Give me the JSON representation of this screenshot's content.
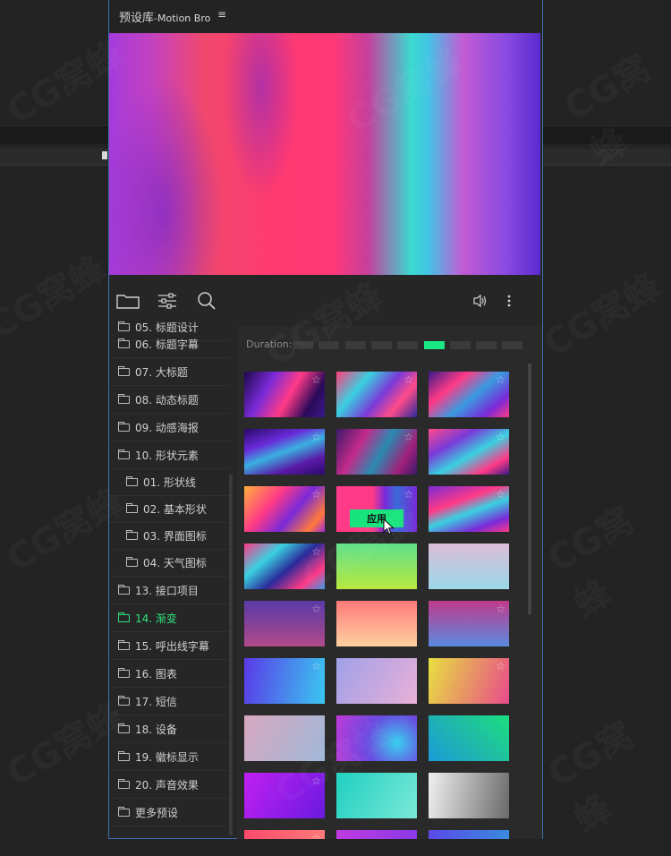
{
  "panel": {
    "title": "预设库",
    "title_sub": "-Motion Bro",
    "menu_glyph": "≡"
  },
  "toolbar": {
    "left_icons": [
      "folder-icon",
      "sliders-icon",
      "search-icon"
    ],
    "right_icons": [
      "speaker-icon",
      "more-vertical-icon"
    ]
  },
  "sidebar": {
    "items": [
      {
        "label": "05. 标题设计",
        "indent": false,
        "active": false
      },
      {
        "label": "06. 标题字幕",
        "indent": false,
        "active": false
      },
      {
        "label": "07. 大标题",
        "indent": false,
        "active": false
      },
      {
        "label": "08. 动态标题",
        "indent": false,
        "active": false
      },
      {
        "label": "09. 动感海报",
        "indent": false,
        "active": false
      },
      {
        "label": "10. 形状元素",
        "indent": false,
        "active": false,
        "open": true
      },
      {
        "label": "01. 形状线",
        "indent": true,
        "active": false
      },
      {
        "label": "02. 基本形状",
        "indent": true,
        "active": false
      },
      {
        "label": "03. 界面图标",
        "indent": true,
        "active": false
      },
      {
        "label": "04. 天气图标",
        "indent": true,
        "active": false
      },
      {
        "label": "13. 接口项目",
        "indent": false,
        "active": false
      },
      {
        "label": "14. 渐变",
        "indent": false,
        "active": true
      },
      {
        "label": "15. 呼出线字幕",
        "indent": false,
        "active": false
      },
      {
        "label": "16. 图表",
        "indent": false,
        "active": false
      },
      {
        "label": "17. 短信",
        "indent": false,
        "active": false
      },
      {
        "label": "18. 设备",
        "indent": false,
        "active": false
      },
      {
        "label": "19. 徽标显示",
        "indent": false,
        "active": false
      },
      {
        "label": "20. 声音效果",
        "indent": false,
        "active": false
      },
      {
        "label": "更多预设",
        "indent": false,
        "active": false
      }
    ]
  },
  "duration": {
    "label": "Duration:",
    "segments": 9,
    "selected_index": 5
  },
  "grid": {
    "apply_label": "应用",
    "hover_index": 7,
    "thumbnails": [
      {
        "bg": "linear-gradient(120deg,#1d0a4a 0%,#7a2ad8 30%,#ff3a87 55%,#2b0a5a 80%,#3a1a8a 100%)",
        "star": true
      },
      {
        "bg": "linear-gradient(130deg,#ff3d7a 0%,#3ad0e0 30%,#7a3ad8 55%,#ff4b8a 75%,#2a2a9a 100%)",
        "star": true
      },
      {
        "bg": "linear-gradient(140deg,#3a1a8a 0%,#ff3a87 30%,#3a9ae0 55%,#7a2ad8 80%,#ff3a87 100%)",
        "star": true
      },
      {
        "bg": "linear-gradient(160deg,#2a0a6a 0%,#6a2ad8 30%,#3ab0e0 50%,#5a1aa8 75%,#2a0a6a 100%)",
        "star": true
      },
      {
        "bg": "linear-gradient(120deg,#3a1a6a 0%,#c32a8a 30%,#2a8ab0 55%,#a0207a 80%,#3a1a6a 100%)",
        "star": true
      },
      {
        "bg": "linear-gradient(150deg,#ff4a8a 0%,#7a3ad8 30%,#3ad0e0 55%,#ff3a87 80%,#3a1a8a 100%)",
        "star": true
      },
      {
        "bg": "linear-gradient(130deg,#ffb03a 0%,#ff3a87 35%,#7a2ad8 60%,#ff7a3a 85%,#a02ad8 100%)",
        "star": true
      },
      {
        "bg": "linear-gradient(90deg,#ff3a87 0%,#ff3a87 45%,#7a2ad8 60%,#3a6ad8 75%,#7a2ad8 100%)",
        "star": true
      },
      {
        "bg": "linear-gradient(160deg,#7a2ad8 0%,#ff3a87 35%,#3ad0e0 55%,#7a2ad8 80%,#ff3a87 100%)",
        "star": true
      },
      {
        "bg": "linear-gradient(140deg,#ff3a87 0%,#3ad0e0 30%,#2a2a9a 55%,#ff3a87 80%,#3a9ae0 100%)",
        "star": true
      },
      {
        "bg": "linear-gradient(180deg,#5fe08a 0%,#b8e840 100%)",
        "star": false
      },
      {
        "bg": "linear-gradient(180deg,#dcbcd8 0%,#9ad8e8 100%)",
        "star": false
      },
      {
        "bg": "linear-gradient(180deg,#5a3aa8 0%,#b04a8a 100%)",
        "star": true
      },
      {
        "bg": "linear-gradient(180deg,#ff7a7a 0%,#ffd0a0 100%)",
        "star": false
      },
      {
        "bg": "linear-gradient(180deg,#c03a8a 0%,#5a8ae0 100%)",
        "star": true
      },
      {
        "bg": "linear-gradient(100deg,#5a3ae8 0%,#3ac8f0 100%)",
        "star": true
      },
      {
        "bg": "linear-gradient(120deg,#a0a0e8 0%,#e8b0d8 100%)",
        "star": false
      },
      {
        "bg": "linear-gradient(110deg,#e8e040 0%,#e84a8a 100%)",
        "star": true
      },
      {
        "bg": "linear-gradient(120deg,#d8a8c0 0%,#a0b8d8 100%)",
        "star": false
      },
      {
        "bg": "radial-gradient(circle at 75% 60%,#3ad0f0 0%,#6a4ae0 45%,#c03ad8 100%)",
        "star": false
      },
      {
        "bg": "linear-gradient(45deg,#1a9ad8 0%,#20c0a0 60%,#1ae080 100%)",
        "star": false
      },
      {
        "bg": "linear-gradient(120deg,#c020f0 0%,#6a1ae0 100%)",
        "star": true
      },
      {
        "bg": "linear-gradient(120deg,#20d0c0 0%,#7ae8d8 100%)",
        "star": false
      },
      {
        "bg": "linear-gradient(100deg,#f0f0f0 0%,#6a6a6a 100%)",
        "star": false
      },
      {
        "bg": "linear-gradient(90deg,#ff4a6a 0%,#ff7a7a 100%)",
        "star": true
      },
      {
        "bg": "linear-gradient(90deg,#c03ae0 0%,#8a3ae8 100%)",
        "star": false
      },
      {
        "bg": "linear-gradient(90deg,#5a4ae8 0%,#3a8ae0 100%)",
        "star": false
      }
    ]
  },
  "watermark": "CG窝蜂"
}
